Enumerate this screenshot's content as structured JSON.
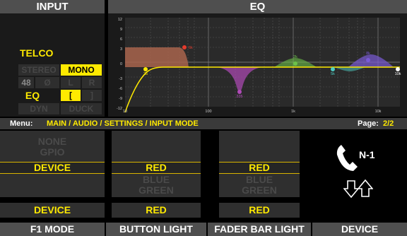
{
  "headers": {
    "input": "INPUT",
    "eq": "EQ"
  },
  "input_panel": {
    "telco": "TELCO",
    "stereo": "STEREO",
    "mono": "MONO",
    "db48": "48",
    "phase": "Ø",
    "left": "L",
    "right": "R",
    "eq": "EQ",
    "bracket_open": "[",
    "bracket_close": "]",
    "dyn": "DYN",
    "duck": "DUCK"
  },
  "eq_graph": {
    "y_ticks": [
      "12",
      "9",
      "6",
      "3",
      "0",
      "-3",
      "-6",
      "-9",
      "-12"
    ],
    "x_ticks": [
      "10",
      "100",
      "1k",
      "10k"
    ],
    "points": [
      {
        "label": "6k",
        "color": "#e53b2c"
      },
      {
        "label": "25",
        "color": "#ffea00"
      },
      {
        "label": "335",
        "color": "#b04ab8"
      },
      {
        "label": "2k",
        "color": "#6cc24a"
      },
      {
        "label": "5k",
        "color": "#4ecdc4"
      },
      {
        "label": "8k",
        "color": "#7a5bd6"
      },
      {
        "label": "10k",
        "color": "#ffffff"
      }
    ]
  },
  "menu": {
    "prefix": "Menu:",
    "path": "MAIN / AUDIO / SETTINGS / INPUT MODE",
    "page_label": "Page:",
    "page_value": "2/2"
  },
  "columns": [
    {
      "options": [
        "NONE",
        "GPIO",
        "DEVICE"
      ],
      "value": "DEVICE",
      "footer": "F1 MODE"
    },
    {
      "options": [
        "RED",
        "BLUE",
        "GREEN"
      ],
      "value": "RED",
      "footer": "BUTTON LIGHT"
    },
    {
      "options": [
        "RED",
        "BLUE",
        "GREEN"
      ],
      "value": "RED",
      "footer": "FADER BAR LIGHT"
    }
  ],
  "device": {
    "label": "N-1",
    "footer": "DEVICE"
  }
}
